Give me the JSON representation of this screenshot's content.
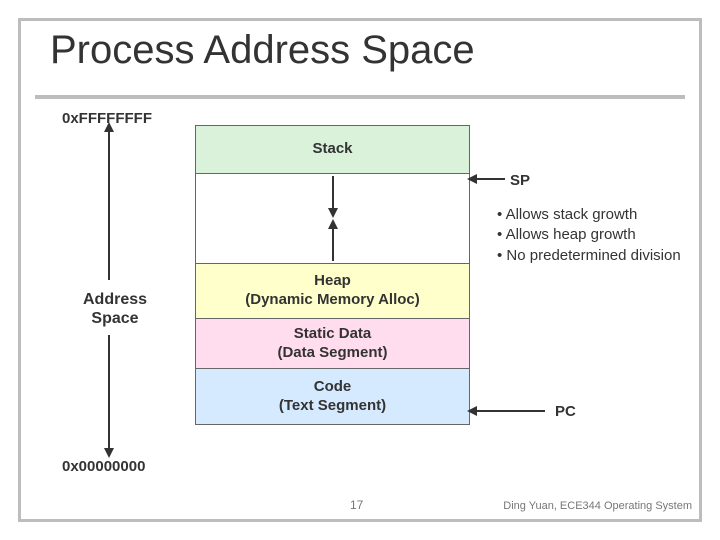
{
  "title": "Process Address Space",
  "top_address": "0xFFFFFFFF",
  "bottom_address": "0x00000000",
  "left_label_line1": "Address",
  "left_label_line2": "Space",
  "segments": {
    "stack": "Stack",
    "heap_line1": "Heap",
    "heap_line2": "(Dynamic Memory Alloc)",
    "data_line1": "Static Data",
    "data_line2": "(Data Segment)",
    "code_line1": "Code",
    "code_line2": "(Text Segment)"
  },
  "pointers": {
    "sp": "SP",
    "pc": "PC"
  },
  "notes": {
    "n1": "• Allows stack growth",
    "n2": "• Allows heap growth",
    "n3": "• No predetermined division"
  },
  "slide_number": "17",
  "credit": "Ding Yuan, ECE344 Operating System"
}
